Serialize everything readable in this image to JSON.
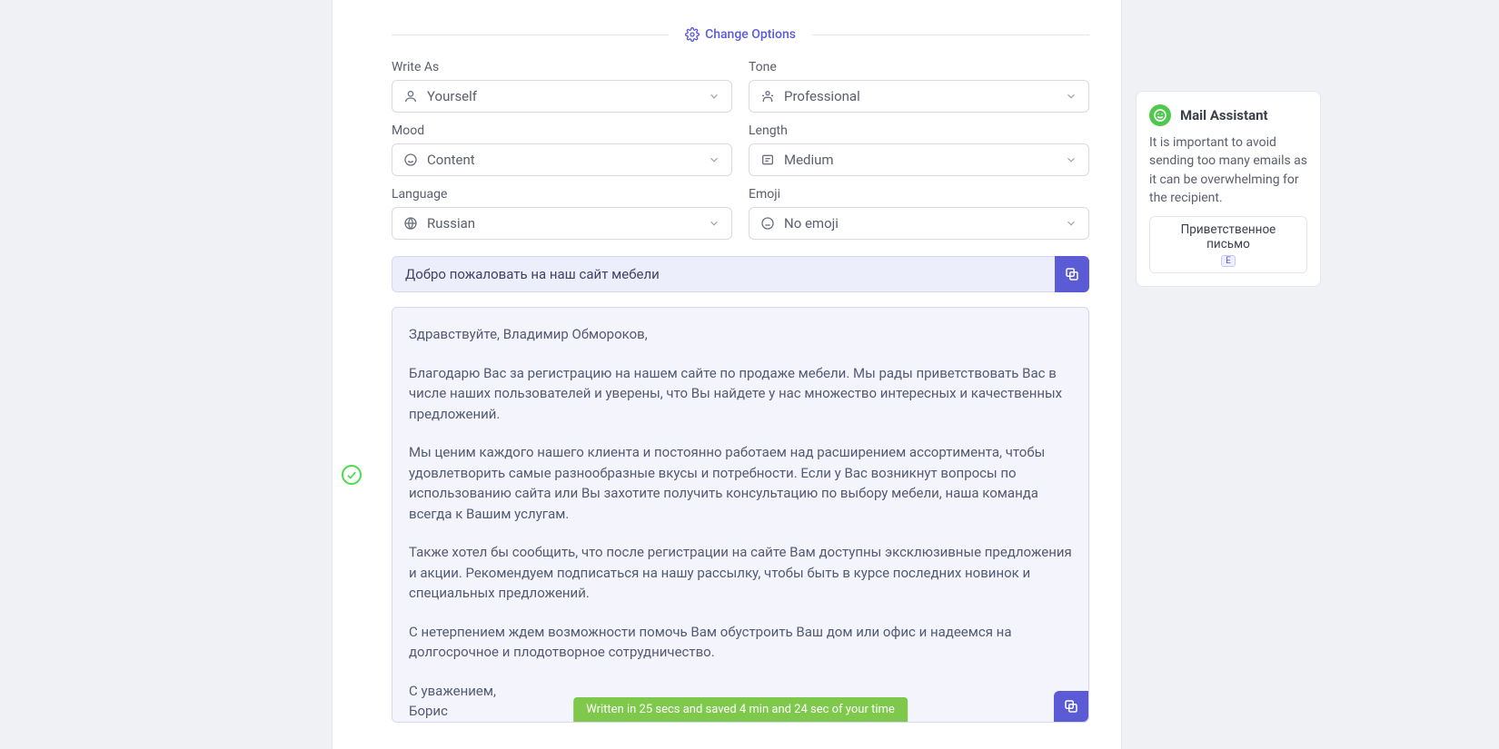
{
  "header": {
    "change_options_label": "Change Options"
  },
  "options": {
    "write_as": {
      "label": "Write As",
      "value": "Yourself"
    },
    "tone": {
      "label": "Tone",
      "value": "Professional"
    },
    "mood": {
      "label": "Mood",
      "value": "Content"
    },
    "length": {
      "label": "Length",
      "value": "Medium"
    },
    "language": {
      "label": "Language",
      "value": "Russian"
    },
    "emoji": {
      "label": "Emoji",
      "value": "No emoji"
    }
  },
  "email": {
    "subject": "Добро пожаловать на наш сайт мебели",
    "greeting": "Здравствуйте, Владимир Обмороков,",
    "p1": "Благодарю Вас за регистрацию на нашем сайте по продаже мебели. Мы рады приветствовать Вас в числе наших пользователей и уверены, что Вы найдете у нас множество интересных и качественных предложений.",
    "p2": "Мы ценим каждого нашего клиента и постоянно работаем над расширением ассортимента, чтобы удовлетворить самые разнообразные вкусы и потребности. Если у Вас возникнут вопросы по использованию сайта или Вы захотите получить консультацию по выбору мебели, наша команда всегда к Вашим услугам.",
    "p3": "Также хотел бы сообщить, что после регистрации на сайте Вам доступны эксклюзивные предложения и акции. Рекомендуем подписаться на нашу рассылку, чтобы быть в курсе последних новинок и специальных предложений.",
    "p4": "С нетерпением ждем возможности помочь Вам обустроить Ваш дом или офис и надеемся на долгосрочное и плодотворное сотрудничество.",
    "signoff": "С уважением,\nБорис"
  },
  "stats": {
    "text": "Written in 25 secs and saved 4 min and 24 sec of your time"
  },
  "assistant": {
    "title": "Mail Assistant",
    "tip": "It is important to avoid sending too many emails as it can be overwhelming for the recipient.",
    "chip": "Приветственное письмо",
    "chip_badge": "E"
  }
}
